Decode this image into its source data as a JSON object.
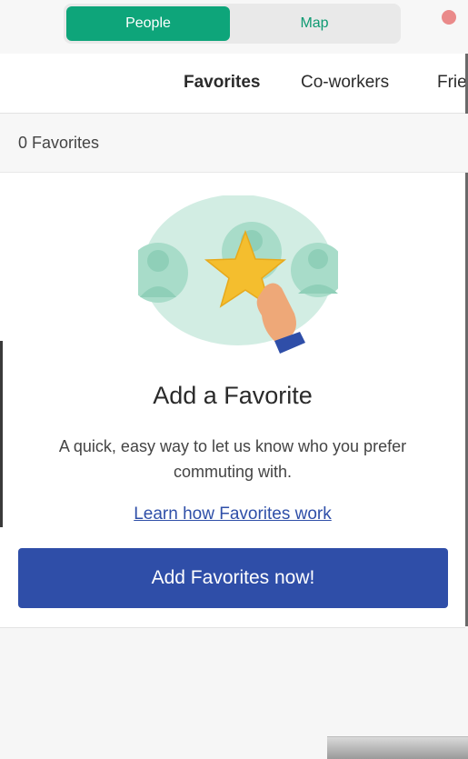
{
  "segment": {
    "people_label": "People",
    "map_label": "Map",
    "selected": "People"
  },
  "tabs": [
    {
      "label": "Favorites",
      "active": true
    },
    {
      "label": "Co-workers",
      "active": false
    },
    {
      "label": "Frie",
      "active": false
    }
  ],
  "favorites_count": "0 Favorites",
  "empty_state": {
    "title": "Add a Favorite",
    "description": "A quick, easy way to let us know who you prefer commuting with.",
    "learn_link": "Learn how Favorites work",
    "cta_label": "Add Favorites now!"
  },
  "colors": {
    "accent_green": "#0ea57a",
    "primary_blue": "#2f4ea8",
    "status_dot": "#ea8a8a"
  },
  "icons": {
    "illustration": "hand-holding-star-illustration",
    "status": "status-dot-icon"
  }
}
